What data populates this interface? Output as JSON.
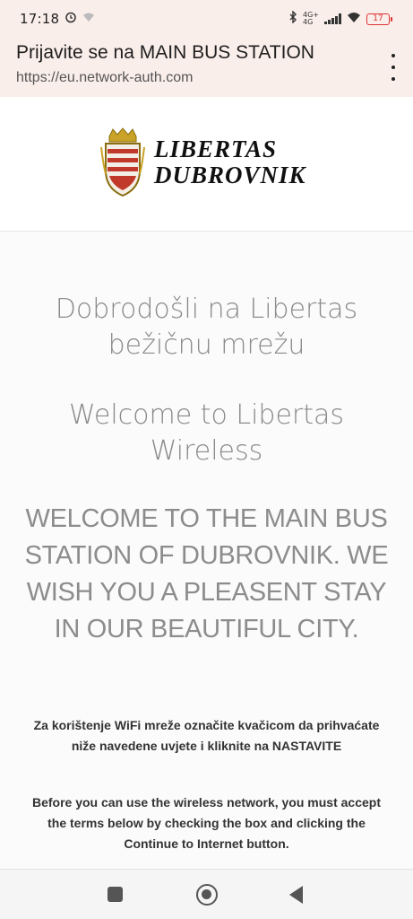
{
  "status_bar": {
    "time": "17:18",
    "alarm_icon": "alarm-icon",
    "wifi_off_icon": "wifi-off-icon",
    "bluetooth_icon": "bluetooth-icon",
    "network_label_top": "4G+",
    "network_label_bottom": "4G",
    "battery": "17"
  },
  "browser": {
    "title": "Prijavite se na MAIN BUS STATION",
    "url": "https://eu.network-auth.com",
    "menu_icon": "more-vertical-icon"
  },
  "logo": {
    "line1": "LIBERTAS",
    "line2": "DUBROVNIK"
  },
  "content": {
    "welcome_hr": "Dobrodošli na Libertas bežičnu mrežu",
    "welcome_en": "Welcome to Libertas Wireless",
    "welcome_big": "WELCOME TO THE MAIN BUS STATION OF DUBROVNIK. WE WISH YOU A PLEASENT STAY IN OUR BEAUTIFUL CITY.",
    "instruction_hr": "Za korištenje WiFi mreže označite kvačicom da prihvaćate niže navedene uvjete i kliknite na NASTAVITE",
    "instruction_en": "Before you can use the wireless network, you must accept the terms below by checking the box and clicking the Continue to Internet button."
  },
  "colors": {
    "header_bg": "#faeeea",
    "crest_red": "#c0392b",
    "crest_gold": "#c9a227"
  }
}
